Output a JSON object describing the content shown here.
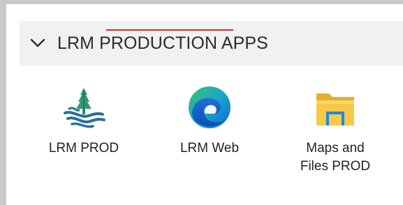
{
  "group": {
    "title": "LRM PRODUCTION APPS",
    "chevron_icon": "chevron-down-icon"
  },
  "apps": [
    {
      "label": "LRM PROD",
      "icon": "lrm-logo-icon"
    },
    {
      "label": "LRM Web",
      "icon": "edge-browser-icon"
    },
    {
      "label": "Maps and\nFiles PROD",
      "icon": "folder-icon"
    }
  ],
  "colors": {
    "header_bg": "#f1f1f1",
    "frame": "#c9c9c9",
    "spell_underline": "#d22a2a",
    "lrm_logo": "#2f7a8c",
    "folder": "#f5c242",
    "edge_blue": "#1b7ad6",
    "edge_green": "#35c26a"
  }
}
